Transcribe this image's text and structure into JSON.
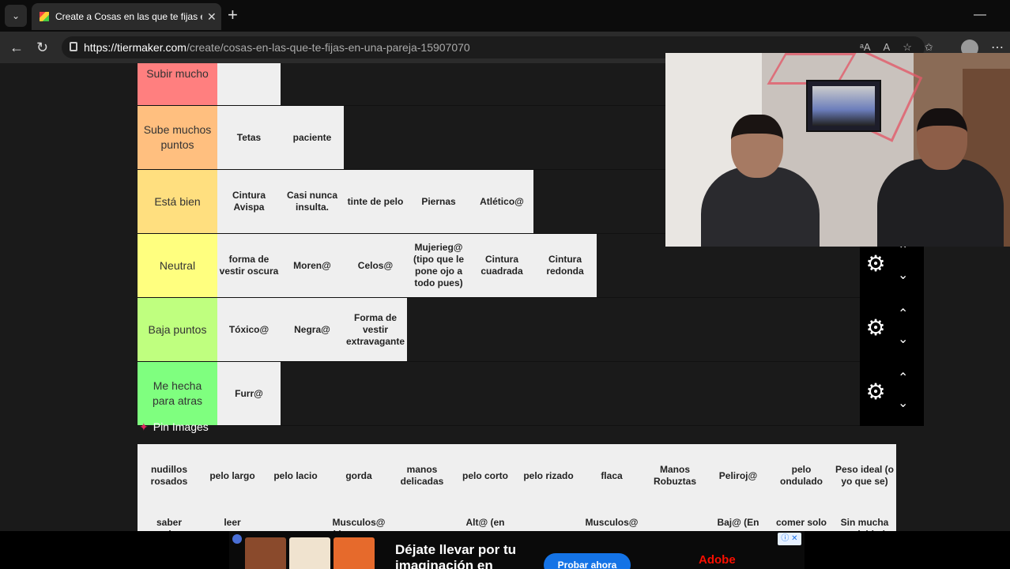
{
  "browser": {
    "tab_title": "Create a Cosas en las que te fijas e",
    "tab_close": "✕",
    "new_tab": "+",
    "minimize": "—",
    "url_host": "https://tiermaker.com",
    "url_path": "/create/cosas-en-las-que-te-fijas-en-una-pareja-15907070",
    "more": "⋯"
  },
  "tiers": [
    {
      "label": "Subir mucho",
      "color": "#ff7f7f",
      "items": [
        ""
      ]
    },
    {
      "label": "Sube muchos puntos",
      "color": "#ffbf7f",
      "items": [
        "Tetas",
        "paciente"
      ]
    },
    {
      "label": "Está bien",
      "color": "#ffdf7f",
      "items": [
        "Cintura Avispa",
        "Casi nunca insulta.",
        "tinte de pelo",
        "Piernas",
        "Atlético@"
      ]
    },
    {
      "label": "Neutral",
      "color": "#ffff7f",
      "items": [
        "forma de vestir oscura",
        "Moren@",
        "Celos@",
        "Mujerieg@ (tipo que le pone ojo a todo pues)",
        "Cintura cuadrada",
        "Cintura redonda"
      ]
    },
    {
      "label": "Baja puntos",
      "color": "#bfff7f",
      "items": [
        "Tóxico@",
        "Negra@",
        "Forma de vestir extravagante"
      ]
    },
    {
      "label": "Me hecha para atras",
      "color": "#7fff7f",
      "items": [
        "Furr@"
      ]
    }
  ],
  "controls": {
    "gear": "⚙",
    "up": "⌃",
    "down": "⌄"
  },
  "pin_images": {
    "icon": "📌",
    "label": "Pin Images"
  },
  "pool": {
    "row1": [
      "nudillos rosados",
      "pelo largo",
      "pelo lacio",
      "gorda",
      "manos delicadas",
      "pelo corto",
      "pelo rizado",
      "flaca",
      "Manos Robuztas",
      "Peliroj@",
      "pelo ondulado",
      "Peso ideal (o yo que se)"
    ],
    "row2": [
      "saber cocinar",
      "leer",
      "",
      "Musculos@ (tipo que va",
      "",
      "Alt@ (en",
      "",
      "Musculos@",
      "",
      "Baj@ (En",
      "comer solo",
      "Sin mucha actividad fisica (solo sano)"
    ]
  },
  "ad": {
    "headline": "Déjate llevar por tu imaginación en",
    "button": "Probar ahora",
    "brand": "Adobe",
    "info": "ⓘ ✕"
  }
}
